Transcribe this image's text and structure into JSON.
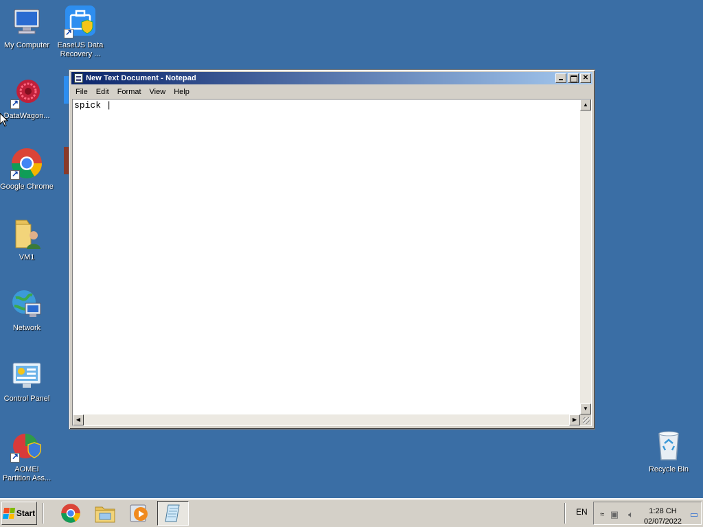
{
  "desktop": {
    "icons": [
      {
        "label": "My Computer"
      },
      {
        "label": "EaseUS Data Recovery ..."
      },
      {
        "label": "DataWagon..."
      },
      {
        "label": "Google Chrome"
      },
      {
        "label": "VM1"
      },
      {
        "label": "Network"
      },
      {
        "label": "Control Panel"
      },
      {
        "label": "AOMEI Partition Ass..."
      },
      {
        "label": "Recycle Bin"
      }
    ]
  },
  "notepad": {
    "title": "New Text Document - Notepad",
    "menu": [
      "File",
      "Edit",
      "Format",
      "View",
      "Help"
    ],
    "content": "spick |"
  },
  "taskbar": {
    "start_label": "Start",
    "language": "EN",
    "time": "1:28 CH",
    "date": "02/07/2022"
  },
  "colors": {
    "desktop_bg": "#3a6ea5",
    "titlebar_start": "#0a246a",
    "titlebar_end": "#a6caf0"
  }
}
